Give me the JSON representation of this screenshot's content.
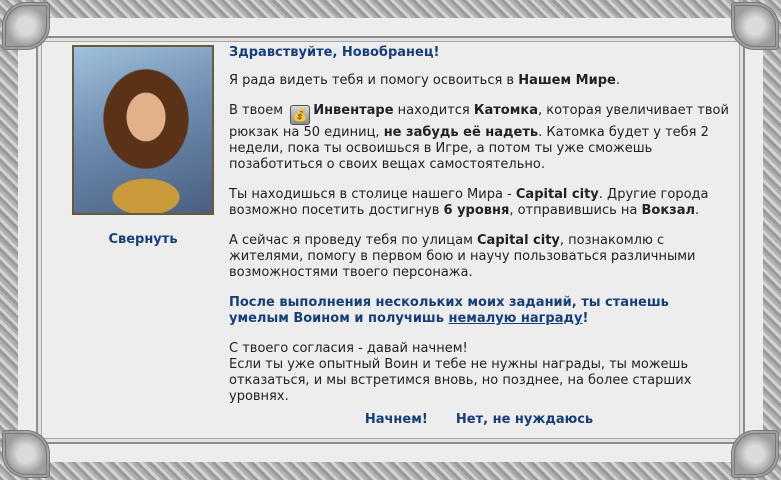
{
  "dialog": {
    "collapse_label": "Свернуть",
    "greeting": "Здравствуйте, Новобранец!",
    "p1": {
      "pre": "Я рада видеть тебя и помогу освоиться в ",
      "bold": "Нашем Мире",
      "post": "."
    },
    "p2": {
      "t1": "В твоем ",
      "icon": "bag-icon",
      "b1": "Инвентаре",
      "t2": " находится ",
      "b2": "Катомка",
      "t3": ", которая увеличивает твой рюкзак на 50 единиц, ",
      "b3": "не забудь её надеть",
      "t4": ". Катомка будет у тебя 2 недели, пока ты освоишься в Игре, а потом ты уже сможешь позаботиться о своих вещах самостоятельно."
    },
    "p3": {
      "t1": "Ты находишься в столице нашего Мира - ",
      "b1": "Capital city",
      "t2": ". Другие города возможно посетить достигнув ",
      "b2": "6 уровня",
      "t3": ", отправившись на ",
      "b3": "Вокзал",
      "t4": "."
    },
    "p4": {
      "t1": "А сейчас я проведу тебя по улицам ",
      "b1": "Capital city",
      "t2": ", познакомлю с жителями, помогу в первом бою и научу пользоваться различными возможностями твоего персонажа."
    },
    "p5": {
      "t1": "После выполнения нескольких моих заданий, ты станешь умелым Воином и получишь ",
      "link": "немалую награду",
      "t2": "!"
    },
    "p6": {
      "line1": "С твоего согласия - давай начнем!",
      "line2": "Если ты уже опытный Воин и тебе не нужны награды, ты можешь отказаться, и мы встретимся вновь, но позднее, на более старших уровнях."
    },
    "accept_label": "Начнем!",
    "decline_label": "Нет, не нуждаюсь"
  },
  "colors": {
    "link": "#173e7a",
    "panel_bg": "#ededed",
    "frame": "#9a9a9a"
  }
}
